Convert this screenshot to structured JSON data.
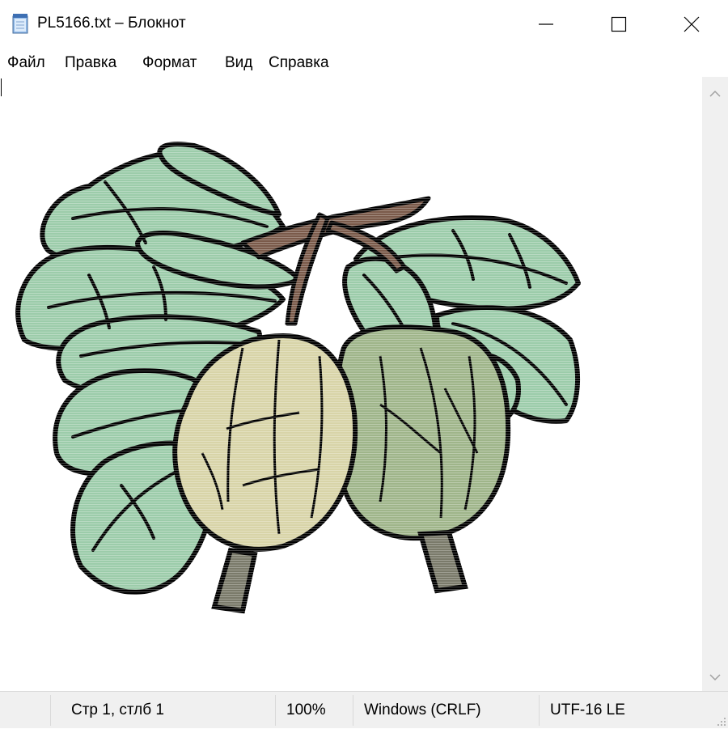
{
  "window": {
    "title": "PL5166.txt – Блокнот"
  },
  "menu": {
    "items": [
      "Файл",
      "Правка",
      "Формат",
      "Вид",
      "Справка"
    ]
  },
  "editor": {
    "content": "ASCII-art image of two gooseberries on a branch with leaves"
  },
  "status": {
    "position": "Стр 1, стлб 1",
    "zoom": "100%",
    "line_endings": "Windows (CRLF)",
    "encoding": "UTF-16 LE"
  },
  "icons": {
    "app": "notepad-icon",
    "minimize": "minimize-icon",
    "maximize": "maximize-icon",
    "close": "close-icon",
    "scroll_up": "chevron-up-icon",
    "scroll_down": "chevron-down-icon"
  },
  "colors": {
    "leaf": "#9cccaa",
    "berry_left": "#d8d4a8",
    "berry_right": "#9fb58a",
    "stem": "#7a5a4a",
    "outline": "#000000",
    "statusbar": "#f0f0f0"
  }
}
